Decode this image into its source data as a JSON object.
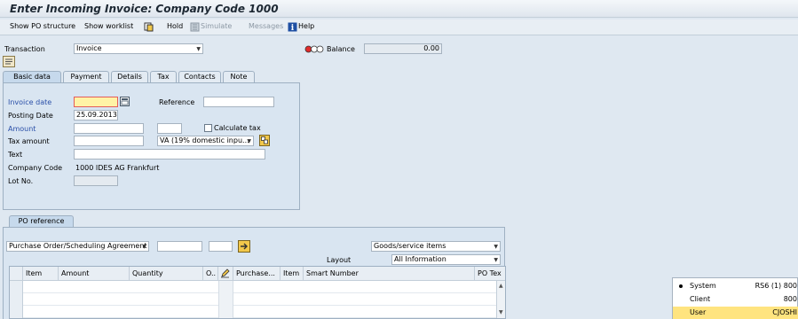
{
  "window": {
    "title": "Enter Incoming Invoice: Company Code 1000"
  },
  "toolbar": {
    "show_po_structure": "Show PO structure",
    "show_worklist": "Show worklist",
    "hold": "Hold",
    "simulate": "Simulate",
    "messages": "Messages",
    "help": "Help"
  },
  "header": {
    "transaction_label": "Transaction",
    "transaction_value": "Invoice",
    "balance_label": "Balance",
    "balance_value": "0.00"
  },
  "tabs": [
    "Basic data",
    "Payment",
    "Details",
    "Tax",
    "Contacts",
    "Note"
  ],
  "basic": {
    "invoice_date_label": "Invoice date",
    "invoice_date_value": "",
    "reference_label": "Reference",
    "reference_value": "",
    "posting_date_label": "Posting Date",
    "posting_date_value": "25.09.2013",
    "amount_label": "Amount",
    "calc_tax_label": "Calculate tax",
    "tax_amount_label": "Tax amount",
    "tax_code_value": "VA (19% domestic inpu...",
    "text_label": "Text",
    "company_code_label": "Company Code",
    "company_code_value": "1000 IDES AG Frankfurt",
    "lot_no_label": "Lot No."
  },
  "po": {
    "tab_label": "PO reference",
    "ref_type": "Purchase Order/Scheduling Agreement",
    "items_type": "Goods/service items",
    "layout_label": "Layout",
    "layout_value": "All Information",
    "columns": [
      "Item",
      "Amount",
      "Quantity",
      "O..",
      "",
      "Purchase...",
      "Item",
      "Smart Number",
      "PO Tex"
    ]
  },
  "status_popup": {
    "items": [
      {
        "key": "System",
        "value": "RS6 (1) 800"
      },
      {
        "key": "Client",
        "value": "800"
      },
      {
        "key": "User",
        "value": "CJOSHI"
      }
    ]
  },
  "colors": {
    "accent": "#2a4fa8",
    "highlight": "#ffe47f",
    "required": "#fff3a6"
  }
}
